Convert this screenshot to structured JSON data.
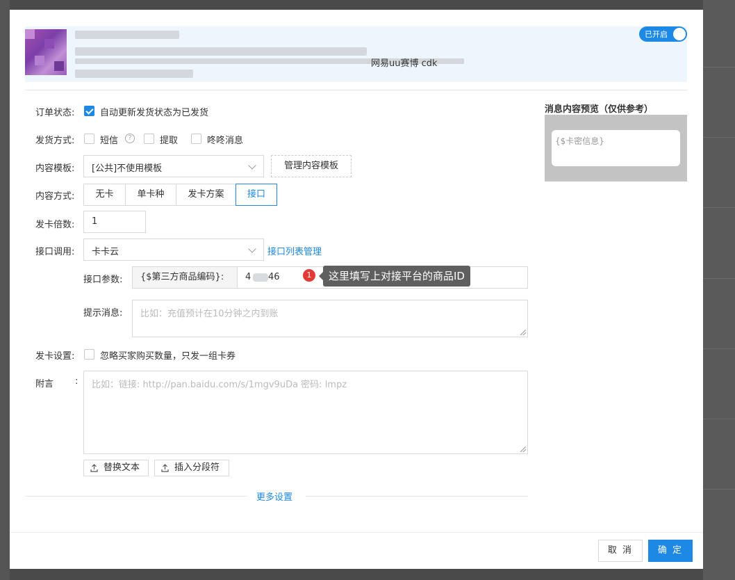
{
  "header": {
    "product_name": "网易uu赛博 cdk",
    "switch_label": "已开启"
  },
  "form": {
    "order_status": {
      "label": "订单状态:",
      "checkbox_label": "自动更新发货状态为已发货",
      "checked": true
    },
    "delivery_method": {
      "label": "发货方式:",
      "options": [
        "短信",
        "提取",
        "咚咚消息"
      ]
    },
    "content_template": {
      "label": "内容模板:",
      "selected": "[公共]不使用模板",
      "manage_button": "管理内容模板"
    },
    "content_mode": {
      "label": "内容方式:",
      "tabs": [
        "无卡",
        "单卡种",
        "发卡方案",
        "接口"
      ],
      "active_index": 3
    },
    "multiplier": {
      "label": "发卡倍数:",
      "value": "1"
    },
    "api_call": {
      "label": "接口调用:",
      "selected": "卡卡云",
      "manage_link": "接口列表管理"
    },
    "api_params": {
      "label": "接口参数:",
      "addon": "{$第三方商品编码}:",
      "value_prefix": "4",
      "value_suffix": "46"
    },
    "tooltip": {
      "badge": "1",
      "text": "这里填写上对接平台的商品ID"
    },
    "hint": {
      "label": "提示消息:",
      "placeholder": "比如：充值预计在10分钟之内到账"
    },
    "card_setting": {
      "label": "发卡设置:",
      "checkbox_label": "忽略买家购买数量，只发一组卡券"
    },
    "note": {
      "label": "附言",
      "colon": ":",
      "placeholder": "比如：链接: http://pan.baidu.com/s/1mgv9uDa 密码: lmpz"
    },
    "buttons": {
      "replace_text": "替换文本",
      "insert_separator": "插入分段符"
    },
    "more_settings": "更多设置"
  },
  "preview": {
    "title": "消息内容预览（仅供参考）",
    "content": "{$卡密信息}"
  },
  "footer": {
    "cancel": "取 消",
    "confirm": "确 定"
  },
  "colors": {
    "accent": "#1e88e5",
    "badge": "#e53935",
    "tooltip_bg": "#5f5f5f"
  }
}
